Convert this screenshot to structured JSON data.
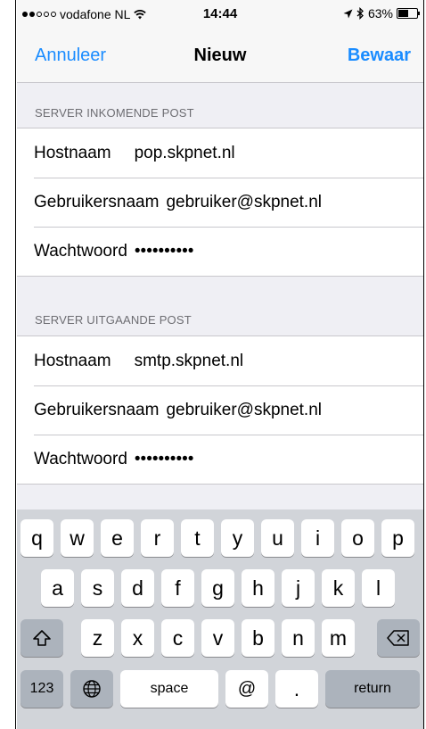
{
  "status": {
    "carrier": "vodafone NL",
    "time": "14:44",
    "battery": "63%",
    "battery_level": 0.63
  },
  "nav": {
    "cancel": "Annuleer",
    "title": "Nieuw",
    "save": "Bewaar"
  },
  "incoming": {
    "header": "SERVER INKOMENDE POST",
    "hostname_label": "Hostnaam",
    "hostname_value": "pop.skpnet.nl",
    "username_label": "Gebruikersnaam",
    "username_value": "gebruiker@skpnet.nl",
    "password_label": "Wachtwoord",
    "password_value": "••••••••••"
  },
  "outgoing": {
    "header": "SERVER UITGAANDE POST",
    "hostname_label": "Hostnaam",
    "hostname_value": "smtp.skpnet.nl",
    "username_label": "Gebruikersnaam",
    "username_value": "gebruiker@skpnet.nl",
    "password_label": "Wachtwoord",
    "password_value": "••••••••••"
  },
  "keyboard": {
    "row1": [
      "q",
      "w",
      "e",
      "r",
      "t",
      "y",
      "u",
      "i",
      "o",
      "p"
    ],
    "row2": [
      "a",
      "s",
      "d",
      "f",
      "g",
      "h",
      "j",
      "k",
      "l"
    ],
    "row3": [
      "z",
      "x",
      "c",
      "v",
      "b",
      "n",
      "m"
    ],
    "numbers": "123",
    "space": "space",
    "at": "@",
    "period": ".",
    "return": "return"
  },
  "colors": {
    "accent": "#1a8cff",
    "background": "#efeff4",
    "keyboard": "#d1d4d9"
  },
  "icons": {
    "wifi": "wifi-icon",
    "location": "location-arrow-icon",
    "bluetooth": "bluetooth-icon",
    "shift": "shift-icon",
    "delete": "backspace-icon",
    "globe": "globe-icon"
  }
}
